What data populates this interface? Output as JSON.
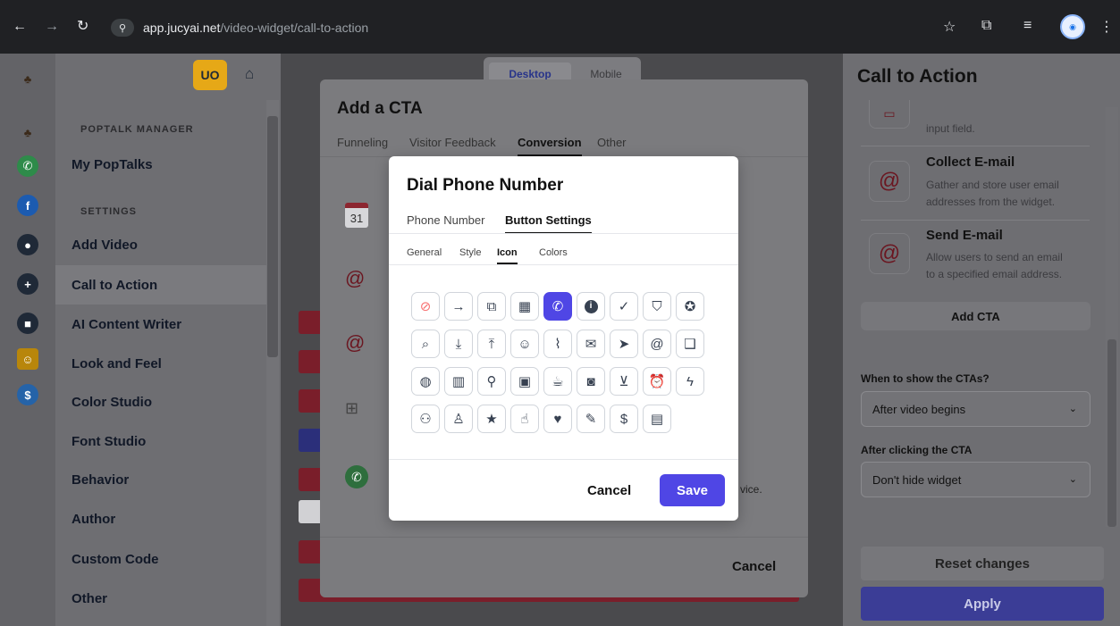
{
  "browser": {
    "domain": "app.jucyai.net",
    "path": "/video-widget/call-to-action",
    "site_icon": "⚲"
  },
  "sidebar": {
    "user_initials": "UO",
    "section_poptalk": "POPTALK MANAGER",
    "my_poptalks": "My PopTalks",
    "section_settings": "SETTINGS",
    "items": [
      {
        "label": "Add Video"
      },
      {
        "label": "Call to Action"
      },
      {
        "label": "AI Content Writer"
      },
      {
        "label": "Look and Feel"
      },
      {
        "label": "Color Studio"
      },
      {
        "label": "Font Studio"
      },
      {
        "label": "Behavior"
      },
      {
        "label": "Author"
      },
      {
        "label": "Custom Code"
      },
      {
        "label": "Other"
      }
    ]
  },
  "preview": {
    "toggle_desktop": "Desktop",
    "toggle_mobile": "Mobile"
  },
  "right_panel": {
    "title": "Call to Action",
    "partial_card_text": "input field.",
    "cards": [
      {
        "title": "Collect E-mail",
        "text_line1": "Gather and store user email",
        "text_line2": "addresses from the widget."
      },
      {
        "title": "Send E-mail",
        "text_line1": "Allow users to send an email",
        "text_line2": "to a specified email address."
      }
    ],
    "add_cta": "Add CTA",
    "when_label": "When to show the CTAs?",
    "when_value": "After video begins",
    "after_label": "After clicking the CTA",
    "after_value": "Don't hide widget",
    "reset": "Reset changes",
    "apply": "Apply"
  },
  "cta_modal": {
    "title": "Add a CTA",
    "tabs": [
      "Funneling",
      "Visitor Feedback",
      "Conversion",
      "Other"
    ],
    "active_tab": "Conversion",
    "calendar_day": "31",
    "partial_text": "vice.",
    "cancel": "Cancel"
  },
  "dial_modal": {
    "title": "Dial Phone Number",
    "tabs": [
      "Phone Number",
      "Button Settings"
    ],
    "active_tab": "Button Settings",
    "subtabs": [
      "General",
      "Style",
      "Icon",
      "Colors"
    ],
    "active_subtab": "Icon",
    "icons": [
      [
        "none-icon",
        "arrow-right-icon",
        "external-link-icon",
        "calendar-icon",
        "phone-icon",
        "info-icon",
        "check-icon",
        "shield-check-icon",
        "badge-check-icon"
      ],
      [
        "search-icon",
        "download-icon",
        "upload-icon",
        "smile-icon",
        "paperclip-icon",
        "envelope-icon",
        "send-icon",
        "at-icon",
        "book-open-icon"
      ],
      [
        "globe-icon",
        "map-icon",
        "map-pin-icon",
        "image-icon",
        "coffee-icon",
        "camera-icon",
        "shopping-cart-icon",
        "alarm-icon",
        "bolt-icon"
      ],
      [
        "users-icon",
        "user-icon",
        "star-icon",
        "thumbs-up-icon",
        "heart-icon",
        "magic-wand-icon",
        "dollar-icon",
        "chart-icon"
      ]
    ],
    "selected_icon": "phone-icon",
    "cancel": "Cancel",
    "save": "Save"
  }
}
